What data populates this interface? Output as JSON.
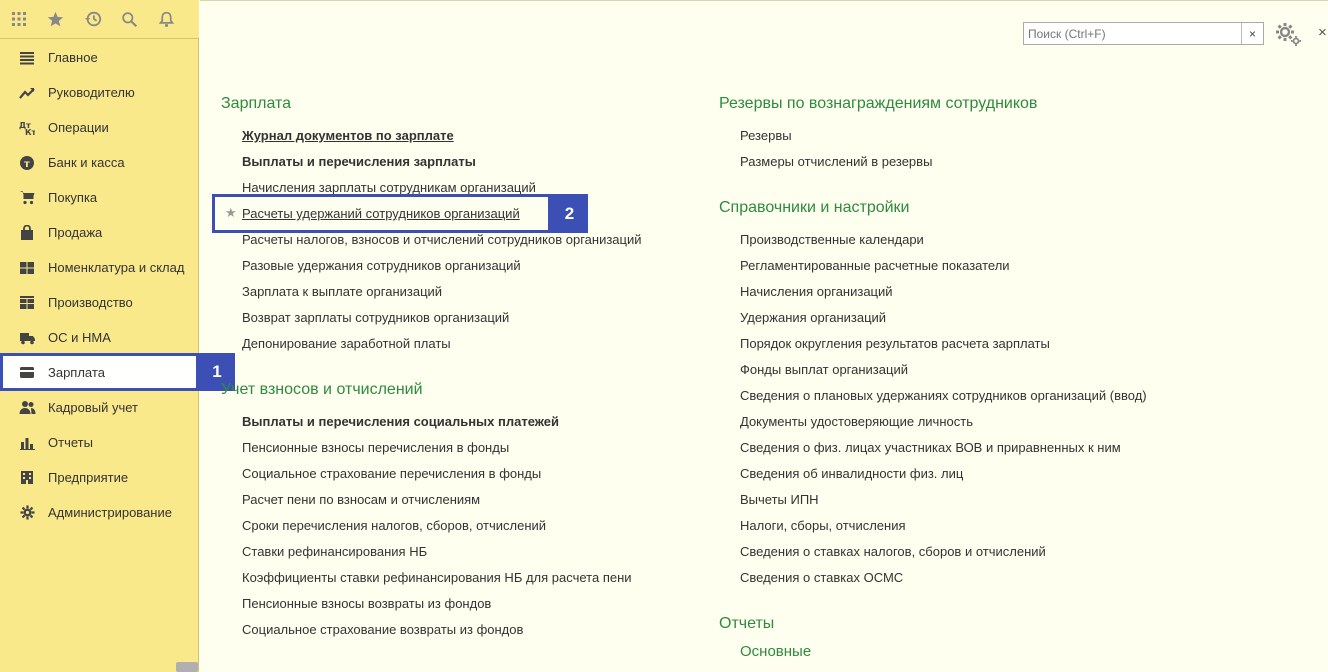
{
  "topbar": {
    "icons": [
      "apps-grid-icon",
      "star-icon",
      "history-icon",
      "search-icon",
      "bell-icon"
    ]
  },
  "nav": [
    {
      "label": "Главное",
      "icon": "menu-lines-icon"
    },
    {
      "label": "Руководителю",
      "icon": "trend-icon"
    },
    {
      "label": "Операции",
      "icon": "debit-credit-icon"
    },
    {
      "label": "Банк и касса",
      "icon": "coin-icon"
    },
    {
      "label": "Покупка",
      "icon": "cart-icon"
    },
    {
      "label": "Продажа",
      "icon": "bag-icon"
    },
    {
      "label": "Номенклатура и склад",
      "icon": "warehouse-icon"
    },
    {
      "label": "Производство",
      "icon": "factory-icon"
    },
    {
      "label": "ОС и НМА",
      "icon": "truck-icon"
    },
    {
      "label": "Зарплата",
      "icon": "wallet-icon",
      "active": true
    },
    {
      "label": "Кадровый учет",
      "icon": "people-icon"
    },
    {
      "label": "Отчеты",
      "icon": "bar-chart-icon"
    },
    {
      "label": "Предприятие",
      "icon": "building-icon"
    },
    {
      "label": "Администрирование",
      "icon": "gear-icon"
    }
  ],
  "search": {
    "placeholder": "Поиск (Ctrl+F)",
    "value": "",
    "clear": "×"
  },
  "close_label": "×",
  "annotations": {
    "badge1": "1",
    "badge2": "2"
  },
  "left": {
    "salary_title": "Зарплата",
    "salary_links": [
      "Журнал документов по зарплате",
      "Выплаты и перечисления зарплаты",
      "Начисления зарплаты сотрудникам организаций",
      "Расчеты удержаний сотрудников организаций",
      "Расчеты налогов, взносов и отчислений сотрудников организаций",
      "Разовые удержания сотрудников организаций",
      "Зарплата к выплате организаций",
      "Возврат зарплаты сотрудников организаций",
      "Депонирование заработной платы"
    ],
    "contrib_title": "Учет взносов и отчислений",
    "contrib_links": [
      "Выплаты и перечисления социальных платежей",
      "Пенсионные взносы перечисления в фонды",
      "Социальное страхование перечисления в фонды",
      "Расчет пени по взносам и отчислениям",
      "Сроки перечисления налогов, сборов, отчислений",
      "Ставки рефинансирования НБ",
      "Коэффициенты ставки рефинансирования НБ для расчета пени",
      "Пенсионные взносы возвраты из фондов",
      "Социальное страхование возвраты из фондов"
    ]
  },
  "right": {
    "reserves_title": "Резервы по вознаграждениям сотрудников",
    "reserves_links": [
      "Резервы",
      "Размеры отчислений в резервы"
    ],
    "ref_title": "Справочники и настройки",
    "ref_links": [
      "Производственные календари",
      "Регламентированные расчетные показатели",
      "Начисления организаций",
      "Удержания организаций",
      "Порядок округления результатов расчета зарплаты",
      "Фонды выплат организаций",
      "Сведения о плановых удержаниях сотрудников организаций (ввод)",
      "Документы удостоверяющие личность",
      "Сведения о физ. лицах участниках ВОВ и приравненных к ним",
      "Сведения об инвалидности физ. лиц",
      "Вычеты ИПН",
      "Налоги, сборы, отчисления",
      "Сведения о ставках налогов, сборов и отчислений",
      "Сведения о ставках ОСМС"
    ],
    "reports_title": "Отчеты",
    "reports_sub": "Основные"
  }
}
